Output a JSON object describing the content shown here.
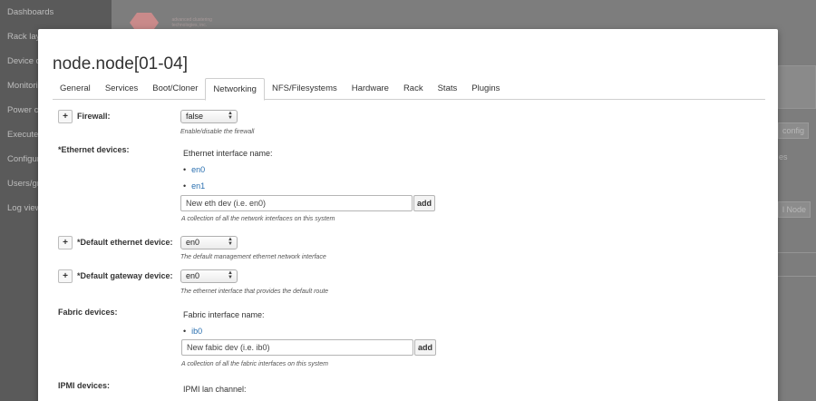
{
  "sidebar": {
    "items": [
      "Dashboards",
      "Rack layout",
      "Device data",
      "Monitoring",
      "Power control",
      "Execute command",
      "Configuration",
      "Users/groups",
      "Log viewer"
    ]
  },
  "background": {
    "logo_text_line1": "advanced clustering",
    "logo_text_line2": "technologies, inc.",
    "config_button": "config",
    "text_es": "es",
    "node_button": "l Node"
  },
  "modal": {
    "title": "node.node[01-04]",
    "tabs": [
      "General",
      "Services",
      "Boot/Cloner",
      "Networking",
      "NFS/Filesystems",
      "Hardware",
      "Rack",
      "Stats",
      "Plugins"
    ],
    "active_tab": "Networking",
    "firewall": {
      "plus": "+",
      "label": "Firewall:",
      "value": "false",
      "help": "Enable/disable the firewall"
    },
    "ethernet": {
      "label": "*Ethernet devices:",
      "sub_label": "Ethernet interface name:",
      "items": [
        "en0",
        "en1"
      ],
      "placeholder": "New eth dev (i.e. en0)",
      "add_label": "add",
      "help": "A collection of all the network interfaces on this system"
    },
    "default_eth": {
      "plus": "+",
      "label": "*Default ethernet device:",
      "value": "en0",
      "help": "The default management ethernet network interface"
    },
    "default_gw": {
      "plus": "+",
      "label": "*Default gateway device:",
      "value": "en0",
      "help": "The ethernet interface that provides the default route"
    },
    "fabric": {
      "label": "Fabric devices:",
      "sub_label": "Fabric interface name:",
      "items": [
        "ib0"
      ],
      "placeholder": "New fabic dev (i.e. ib0)",
      "add_label": "add",
      "help": "A collection of all the fabric interfaces on this system"
    },
    "ipmi": {
      "label": "IPMI devices:",
      "sub_label": "IPMI lan channel:"
    }
  }
}
